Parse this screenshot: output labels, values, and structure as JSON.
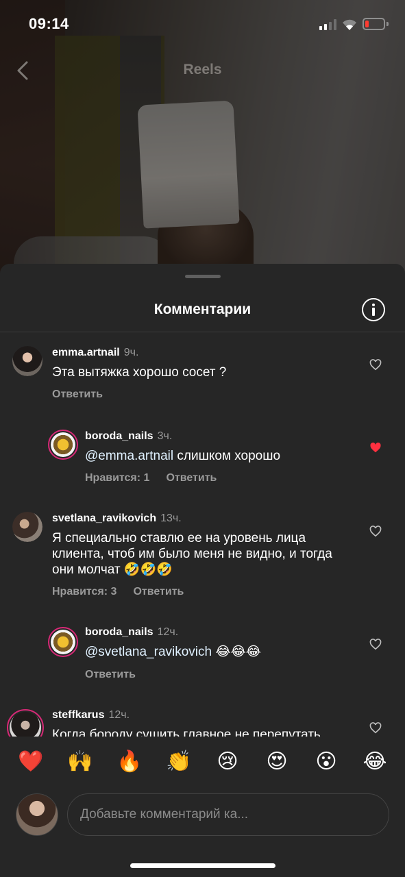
{
  "status_bar": {
    "time": "09:14"
  },
  "header": {
    "title": "Reels"
  },
  "sheet": {
    "title": "Комментарии"
  },
  "comments": [
    {
      "user": "emma.artnail",
      "time": "9ч.",
      "text": "Эта вытяжка хорошо сосет ?",
      "likes": "",
      "reply": "Ответить",
      "liked": false
    },
    {
      "user": "boroda_nails",
      "time": "3ч.",
      "mention": "@emma.artnail",
      "text": " слишком хорошо",
      "likes": "Нравится: 1",
      "reply": "Ответить",
      "liked": true
    },
    {
      "user": "svetlana_ravikovich",
      "time": "13ч.",
      "text": "Я специально ставлю ее на уровень лица клиента, чтоб им было меня не видно, и тогда они молчат 🤣🤣🤣",
      "likes": "Нравится: 3",
      "reply": "Ответить",
      "liked": false
    },
    {
      "user": "boroda_nails",
      "time": "12ч.",
      "mention": "@svetlana_ravikovich",
      "text": " 😂😂😂",
      "likes": "",
      "reply": "Ответить",
      "liked": false
    },
    {
      "user": "steffkarus",
      "time": "12ч.",
      "text": "Когда бороду сушить главное не перепутать",
      "liked": false
    }
  ],
  "emojis": [
    "❤️",
    "🙌",
    "🔥",
    "👏",
    "😢",
    "😍",
    "😮",
    "😂"
  ],
  "input": {
    "placeholder": "Добавьте комментарий ка..."
  },
  "colors": {
    "sheet_bg": "#262626",
    "like_red": "#ff3040",
    "story_ring": "#d62976"
  }
}
